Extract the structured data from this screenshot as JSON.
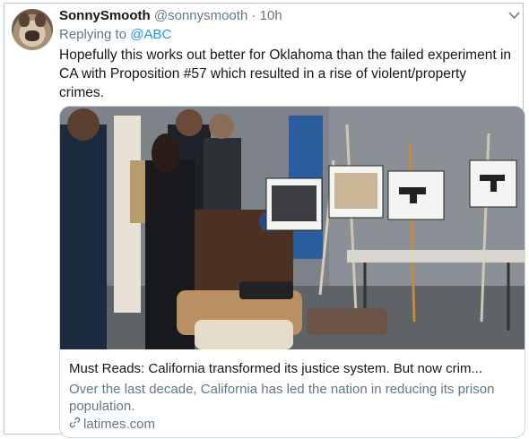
{
  "tweet": {
    "name": "SonnySmooth",
    "handle": "@sonnysmooth",
    "separator": "·",
    "time": "10h",
    "replying_prefix": "Replying to",
    "replying_to": "@ABC",
    "text": "Hopefully this works out better for Oklahoma than the failed experiment in CA with Proposition #57 which resulted in a rise of violent/property crimes."
  },
  "card": {
    "title": "Must Reads: California transformed its justice system. But now crim...",
    "description": "Over the last decade, California has led the nation in reducing its prison population.",
    "domain": "latimes.com"
  },
  "icons": {
    "menu": "chevron-down-icon",
    "link": "link-icon",
    "avatar": "bulldog-avatar"
  }
}
